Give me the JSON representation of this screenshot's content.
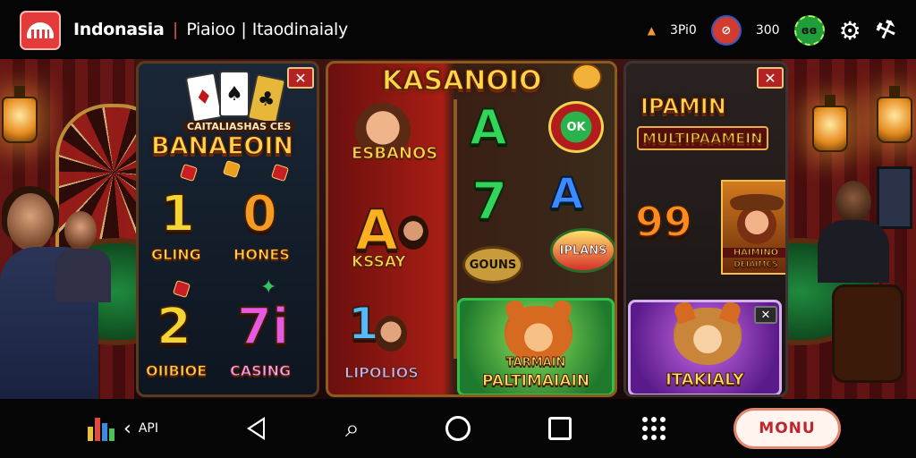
{
  "header": {
    "title": "Indonasia",
    "separator": "|",
    "tag1": "Piaioo",
    "tag2": "Itaodinaialy",
    "stat1": "3Pi0",
    "stat2": "300",
    "green_badge": "ɞɞ"
  },
  "panels": {
    "left": {
      "badge": "✕",
      "small_heading": "CAITALIASHAS CES",
      "heading": "BANAEOIN",
      "items": [
        {
          "num": "1",
          "label": "GLING"
        },
        {
          "num": "0",
          "label": "HONES"
        },
        {
          "num": "2",
          "label": "OIIBIOE"
        },
        {
          "num": "7i",
          "label": "CASING"
        }
      ]
    },
    "middle": {
      "title": "KASANOIO",
      "promo_label": "ESBANOS",
      "feature_letter": "A",
      "feature_label": "KSSAY",
      "bottom_num": "1",
      "bottom_label": "LIPOLIOS",
      "slot_a": "A",
      "slot_7": "7",
      "chip_ok": "OK",
      "slot_a2": "A",
      "gouns": "GOUNS",
      "iplans": "IPLANS",
      "tile_label_top": "TARMAIN",
      "tile_label": "PALTIMAIAIN"
    },
    "right": {
      "badge": "✕",
      "heading_top": "IPAMIN",
      "heading": "MULTIPAAMEIN",
      "num": "99",
      "card_label_top": "HAIMINO",
      "card_label": "DEIAIMCS",
      "tile_label": "ITAKIALY",
      "tile_badge": "✕"
    }
  },
  "navbar": {
    "api_label": "API",
    "menu_button": "MONU"
  },
  "colors": {
    "accent_red": "#c0252d",
    "gold": "#ffd54a",
    "green": "#30c048"
  }
}
